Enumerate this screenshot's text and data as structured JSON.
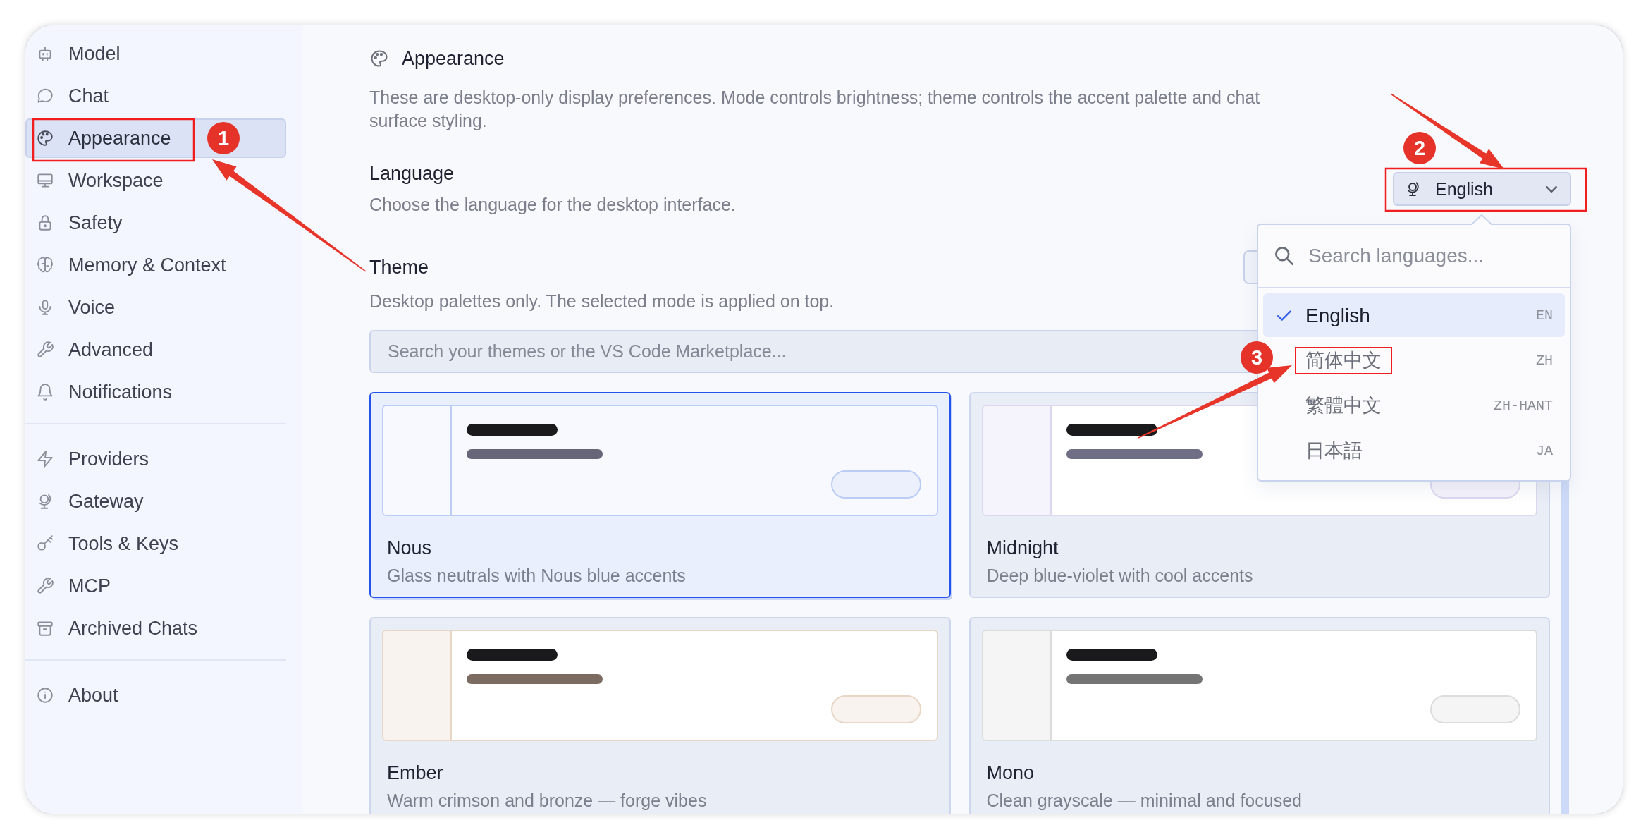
{
  "sidebar": {
    "groups": [
      {
        "items": [
          {
            "label": "Model",
            "selected": false
          },
          {
            "label": "Chat",
            "selected": false
          },
          {
            "label": "Appearance",
            "selected": true
          },
          {
            "label": "Workspace",
            "selected": false
          },
          {
            "label": "Safety",
            "selected": false
          },
          {
            "label": "Memory & Context",
            "selected": false
          },
          {
            "label": "Voice",
            "selected": false
          },
          {
            "label": "Advanced",
            "selected": false
          },
          {
            "label": "Notifications",
            "selected": false
          }
        ]
      },
      {
        "items": [
          {
            "label": "Providers",
            "selected": false
          },
          {
            "label": "Gateway",
            "selected": false
          },
          {
            "label": "Tools & Keys",
            "selected": false
          },
          {
            "label": "MCP",
            "selected": false
          },
          {
            "label": "Archived Chats",
            "selected": false
          }
        ]
      },
      {
        "items": [
          {
            "label": "About",
            "selected": false
          }
        ]
      }
    ]
  },
  "page": {
    "title": "Appearance",
    "description": "These are desktop-only display preferences. Mode controls brightness; theme controls the accent palette and chat surface styling."
  },
  "language": {
    "label": "Language",
    "description": "Choose the language for the desktop interface.",
    "select": {
      "value": "English",
      "expanded": true
    },
    "menu": {
      "search": {
        "placeholder": "Search languages..."
      },
      "options": [
        {
          "label": "English",
          "code": "EN",
          "selected": true,
          "highlighted": false
        },
        {
          "label": "简体中文",
          "code": "ZH",
          "selected": false,
          "highlighted": true
        },
        {
          "label": "繁體中文",
          "code": "ZH-HANT",
          "selected": false,
          "highlighted": false
        },
        {
          "label": "日本語",
          "code": "JA",
          "selected": false,
          "highlighted": false
        }
      ]
    }
  },
  "theme": {
    "label": "Theme",
    "description": "Desktop palettes only. The selected mode is applied on top.",
    "search": {
      "placeholder": "Search your themes or the VS Code Marketplace..."
    },
    "cards": [
      {
        "name": "Nous",
        "description": "Glass neutrals with Nous blue accents",
        "selected": true,
        "preview": {
          "text_bar": {
            "color": "#676678"
          },
          "button": {
            "color": "#bccdf5"
          }
        }
      },
      {
        "name": "Midnight",
        "description": "Deep blue-violet with cool accents",
        "selected": false,
        "preview": {
          "text_bar": {
            "color": "#6f6e85"
          },
          "button": {
            "color": "#ddd8f0"
          }
        }
      },
      {
        "name": "Ember",
        "description": "Warm crimson and bronze — forge vibes",
        "selected": false,
        "preview": {
          "text_bar": {
            "color": "#7b6b61"
          },
          "button": {
            "color": "#e8d7c6"
          }
        }
      },
      {
        "name": "Mono",
        "description": "Clean grayscale — minimal and focused",
        "selected": false,
        "preview": {
          "text_bar": {
            "color": "#747474"
          },
          "button": {
            "color": "#dcdcdc"
          }
        }
      }
    ]
  },
  "annotations": [
    {
      "number": "1"
    },
    {
      "number": "2"
    },
    {
      "number": "3"
    }
  ]
}
